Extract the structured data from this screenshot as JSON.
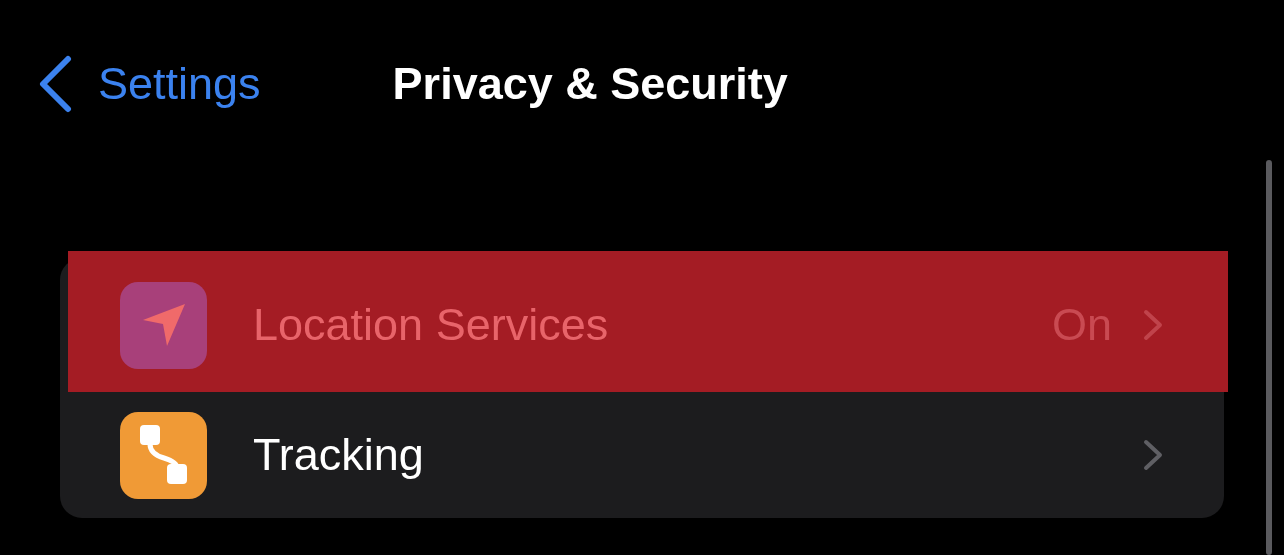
{
  "nav_bar": {
    "back_label": "Settings",
    "title": "Privacy & Security"
  },
  "rows": [
    {
      "kind": "location",
      "label": "Location Services",
      "value": "On",
      "color": "#a8407a",
      "highlighted": true
    },
    {
      "kind": "tracking",
      "label": "Tracking",
      "color": "#f09a36",
      "highlighted": false
    }
  ]
}
